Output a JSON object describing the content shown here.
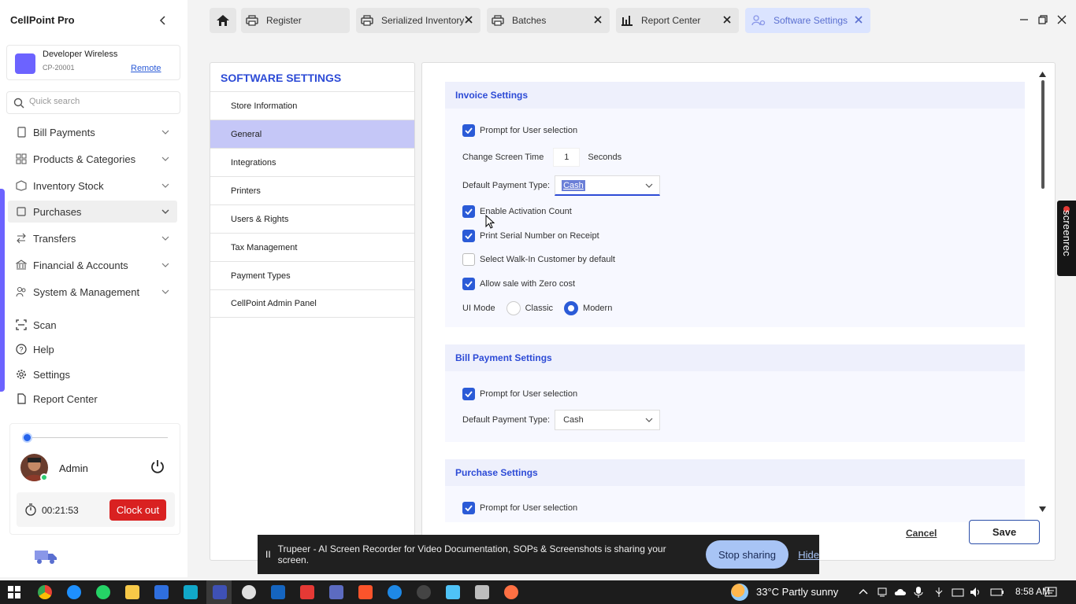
{
  "app": {
    "title": "CellPoint Pro"
  },
  "store": {
    "name": "Developer Wireless",
    "id": "CP-20001",
    "remote_label": "Remote"
  },
  "search": {
    "placeholder": "Quick search"
  },
  "nav": {
    "items": [
      {
        "label": "Bill Payments",
        "icon": "receipt-icon"
      },
      {
        "label": "Products & Categories",
        "icon": "grid-icon"
      },
      {
        "label": "Inventory Stock",
        "icon": "box-icon"
      },
      {
        "label": "Purchases",
        "icon": "cart-icon"
      },
      {
        "label": "Transfers",
        "icon": "swap-icon"
      },
      {
        "label": "Financial & Accounts",
        "icon": "bank-icon"
      },
      {
        "label": "System & Management",
        "icon": "people-icon"
      }
    ],
    "links": [
      {
        "label": "Scan",
        "icon": "scan-icon"
      },
      {
        "label": "Help",
        "icon": "help-icon"
      },
      {
        "label": "Settings",
        "icon": "gear-icon"
      },
      {
        "label": "Report Center",
        "icon": "document-icon"
      }
    ]
  },
  "user": {
    "name": "Admin",
    "timer": "00:21:53",
    "clock_out_label": "Clock out"
  },
  "tabs": [
    {
      "label": "Register"
    },
    {
      "label": "Serialized Inventory"
    },
    {
      "label": "Batches"
    },
    {
      "label": "Report Center"
    },
    {
      "label": "Software Settings"
    }
  ],
  "settings_menu": {
    "title": "SOFTWARE SETTINGS",
    "items": [
      "Store Information",
      "General",
      "Integrations",
      "Printers",
      "Users & Rights",
      "Tax Management",
      "Payment Types",
      "CellPoint Admin Panel"
    ],
    "active": "General"
  },
  "invoice": {
    "title": "Invoice Settings",
    "prompt_user": "Prompt for User selection",
    "change_screen_time_label": "Change Screen Time",
    "change_screen_time_value": "1",
    "seconds_label": "Seconds",
    "payment_type_label": "Default Payment Type:",
    "payment_type_value": "Cash",
    "enable_activation": "Enable Activation Count",
    "print_serial": "Print Serial Number on Receipt",
    "walk_in": "Select Walk-In Customer by default",
    "zero_cost": "Allow sale with Zero cost",
    "ui_mode_label": "UI Mode",
    "ui_mode_classic": "Classic",
    "ui_mode_modern": "Modern"
  },
  "bill_payment": {
    "title": "Bill Payment Settings",
    "prompt_user": "Prompt for User selection",
    "payment_type_label": "Default Payment Type:",
    "payment_type_value": "Cash"
  },
  "purchase": {
    "title": "Purchase Settings",
    "prompt_user": "Prompt for User selection"
  },
  "actions": {
    "cancel": "Cancel",
    "save": "Save"
  },
  "share_bar": {
    "pause": "II",
    "text": "Trupeer - AI Screen Recorder for Video Documentation, SOPs & Screenshots is sharing your screen.",
    "stop": "Stop sharing",
    "hide": "Hide"
  },
  "screenrec": {
    "label": "screenrec"
  },
  "taskbar": {
    "weather": "33°C  Partly sunny",
    "time": "8:58 AM"
  },
  "colors": {
    "accent": "#2d4bd6",
    "brand": "#6c63ff",
    "danger": "#d92121",
    "active_menu": "#c5c7f7"
  }
}
